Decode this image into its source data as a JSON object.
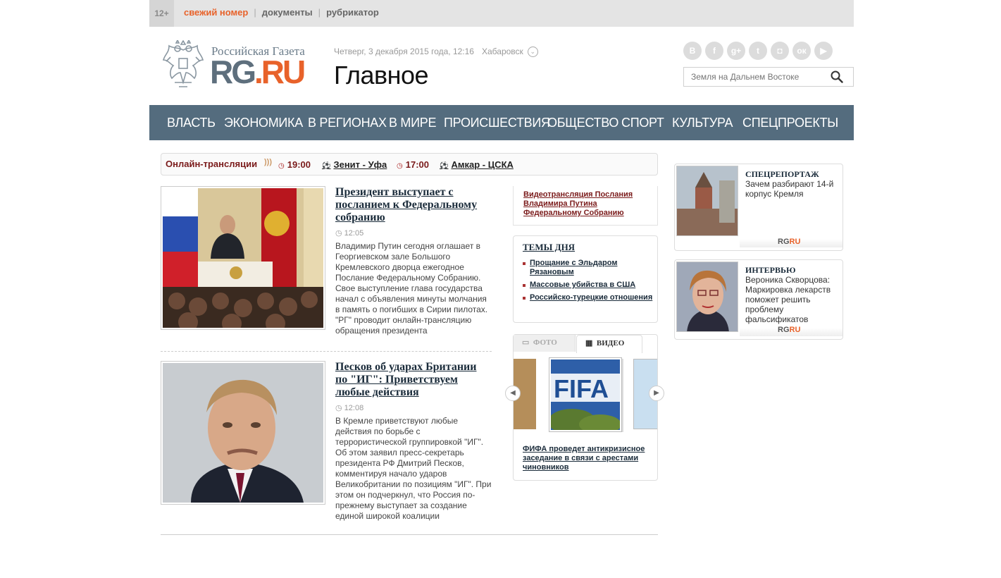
{
  "topbar": {
    "age": "12+",
    "links": [
      "свежий номер",
      "документы",
      "рубрикатор"
    ]
  },
  "header": {
    "logo_title": "Российская Газета",
    "logo_rg": "RG",
    "logo_dot": ".",
    "logo_ru": "RU",
    "date": "Четверг, 3 декабря 2015 года, 12:16",
    "city": "Хабаровск",
    "section": "Главное",
    "search_placeholder": "Земля на Дальнем Востоке",
    "social_icons": [
      "vk-icon",
      "facebook-icon",
      "googleplus-icon",
      "twitter-icon",
      "instagram-icon",
      "odnoklassniki-icon",
      "youtube-icon"
    ]
  },
  "nav": {
    "items": [
      "ВЛАСТЬ",
      "ЭКОНОМИКА",
      "В РЕГИОНАХ",
      "В МИРЕ",
      "ПРОИСШЕСТВИЯ",
      "ОБЩЕСТВО",
      "СПОРТ",
      "КУЛЬТУРА",
      "СПЕЦПРОЕКТЫ"
    ]
  },
  "live": {
    "label": "Онлайн-трансляции",
    "matches": [
      {
        "time": "19:00",
        "title": "Зенит - Уфа"
      },
      {
        "time": "17:00",
        "title": "Амкар - ЦСКА"
      }
    ]
  },
  "news": [
    {
      "title": "Президент выступает с посланием к Федеральному собранию",
      "time": "12:05",
      "text": "Владимир Путин сегодня оглашает в Георгиевском зале Большого Кремлевского дворца ежегодное Послание Федеральному Собранию. Свое выступление глава государства начал с объявления минуты молчания в память о погибших в Сирии пилотах. \"РГ\" проводит онлайн-трансляцию обращения президента"
    },
    {
      "title": "Песков об ударах Британии по \"ИГ\": Приветствуем любые действия",
      "time": "12:08",
      "text": "В Кремле приветствуют любые действия по борьбе с террористической группировкой \"ИГ\". Об этом заявил пресс-секретарь президента РФ Дмитрий Песков, комментируя начало ударов Великобритании по позициям \"ИГ\". При этом он подчеркнул, что Россия по-прежнему выступает за создание единой широкой коалиции"
    }
  ],
  "mid": {
    "broadcast_link": "Видеотрансляция Послания Владимира Путина Федеральному Собранию",
    "themes_title": "ТЕМЫ ДНЯ",
    "themes": [
      "Прощание с Эльдаром Рязановым",
      "Массовые убийства в США",
      "Российско-турецкие отношения"
    ],
    "tab_photo": "ФОТО",
    "tab_video": "ВИДЕО",
    "video_caption": "ФИФА проведет антикризисное заседание в связи с арестами чиновников",
    "thumb_text": "FIFA"
  },
  "right": {
    "cards": [
      {
        "kicker": "СПЕЦРЕПОРТАЖ",
        "text": "Зачем разбирают 14-й корпус Кремля"
      },
      {
        "kicker": "ИНТЕРВЬЮ",
        "text": "Вероника Скворцова: Маркировка лекарств поможет решить проблему фальсификатов"
      }
    ],
    "watermark_rg": "RG",
    "watermark_ru": "RU"
  },
  "colors": {
    "accent": "#e8622a",
    "nav_bg": "#546c7e",
    "topbar_bg": "#e4e4e4",
    "live_red": "#7a1a1a"
  }
}
